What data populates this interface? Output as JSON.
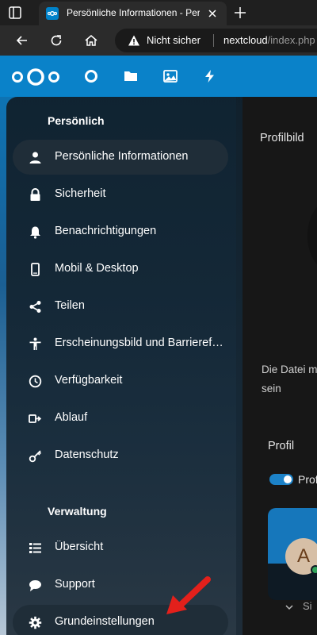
{
  "browser": {
    "tab_title": "Persönliche Informationen - Persönlich",
    "omnibox_security": "Nicht sicher",
    "url_host": "nextcloud",
    "url_path": "/index.php"
  },
  "sidebar": {
    "section_personal": "Persönlich",
    "section_admin": "Verwaltung",
    "personal_items": [
      {
        "label": "Persönliche Informationen",
        "icon": "user-icon",
        "active": true
      },
      {
        "label": "Sicherheit",
        "icon": "lock-icon"
      },
      {
        "label": "Benachrichtigungen",
        "icon": "bell-icon"
      },
      {
        "label": "Mobil & Desktop",
        "icon": "phone-icon"
      },
      {
        "label": "Teilen",
        "icon": "share-icon"
      },
      {
        "label": "Erscheinungsbild und Barrierefreiheit",
        "icon": "accessibility-icon"
      },
      {
        "label": "Verfügbarkeit",
        "icon": "clock-icon"
      },
      {
        "label": "Ablauf",
        "icon": "flow-icon"
      },
      {
        "label": "Datenschutz",
        "icon": "key-icon"
      }
    ],
    "admin_items": [
      {
        "label": "Übersicht",
        "icon": "list-icon"
      },
      {
        "label": "Support",
        "icon": "chat-icon"
      },
      {
        "label": "Grundeinstellungen",
        "icon": "gear-icon"
      }
    ]
  },
  "main": {
    "profile_picture_heading": "Profilbild",
    "file_note_line1": "Die Datei m",
    "file_note_line2": "sein",
    "profile_heading": "Profil",
    "toggle_label": "Prof",
    "avatar_initial": "A",
    "collapsed_label": "Si"
  },
  "colors": {
    "brand": "#0082c9",
    "arrow": "#e3201b"
  }
}
